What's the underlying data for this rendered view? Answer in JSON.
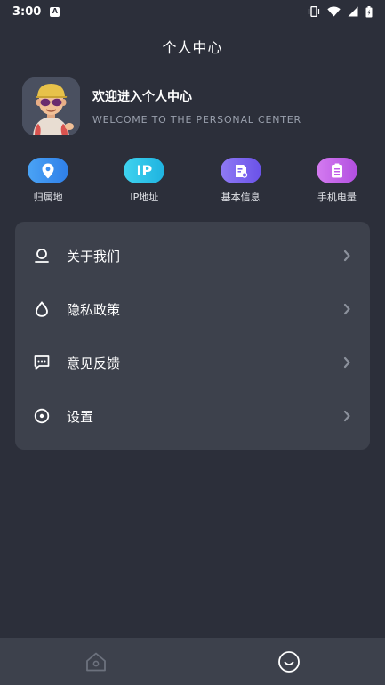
{
  "status_bar": {
    "time": "3:00",
    "notif_glyph": "A",
    "icons": [
      "vibrate-icon",
      "wifi-icon",
      "signal-icon",
      "battery-icon"
    ]
  },
  "header": {
    "title": "个人中心"
  },
  "profile": {
    "avatar": "avatar-cartoon-boy",
    "welcome_cn": "欢迎进入个人中心",
    "welcome_en": "WELCOME TO THE PERSONAL CENTER"
  },
  "quick_actions": [
    {
      "label": "归属地",
      "icon": "location-pin-icon",
      "color": "#3b8ff0"
    },
    {
      "label": "IP地址",
      "icon": "ip-text-icon",
      "icon_text": "IP",
      "color": "#27c4e8"
    },
    {
      "label": "基本信息",
      "icon": "info-card-icon",
      "color": "#7a63f0"
    },
    {
      "label": "手机电量",
      "icon": "battery-clipboard-icon",
      "color": "#c05be8"
    }
  ],
  "menu": {
    "items": [
      {
        "label": "关于我们",
        "icon": "person-icon"
      },
      {
        "label": "隐私政策",
        "icon": "drop-icon"
      },
      {
        "label": "意见反馈",
        "icon": "feedback-chat-icon"
      },
      {
        "label": "设置",
        "icon": "settings-icon"
      }
    ]
  },
  "bottom_nav": {
    "tabs": [
      {
        "name": "home",
        "icon": "home-icon",
        "active": false
      },
      {
        "name": "profile",
        "icon": "smile-icon",
        "active": true
      }
    ]
  },
  "colors": {
    "background": "#2c2f3a",
    "card": "#3d414c",
    "text_primary": "#ffffff",
    "text_secondary": "#9aa0ad"
  }
}
